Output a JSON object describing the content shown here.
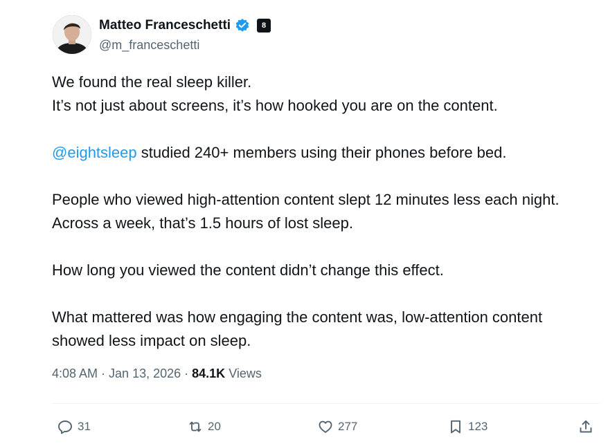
{
  "author": {
    "display_name": "Matteo Franceschetti",
    "handle": "@m_franceschetti",
    "affiliation_badge": "8"
  },
  "tweet": {
    "line1": "We found the real sleep killer.",
    "line2": "It’s not just about screens, it’s how hooked you are on the content.",
    "mention": "@eightsleep",
    "mention_rest": " studied 240+ members using their phones before bed.",
    "para3": "People who viewed high-attention content slept 12 minutes less each night. Across a week, that’s 1.5 hours of lost sleep.",
    "para4": "How long you viewed the content didn’t change this effect.",
    "para5": "What mattered was how engaging the content was, low-attention content showed less impact on sleep."
  },
  "meta": {
    "time": "4:08 AM",
    "sep1": " · ",
    "date": "Jan 13, 2026",
    "sep2": " · ",
    "views_count": "84.1K",
    "views_label": " Views"
  },
  "actions": {
    "replies": "31",
    "reposts": "20",
    "likes": "277",
    "bookmarks": "123"
  },
  "colors": {
    "text": "#0f1419",
    "secondary": "#536471",
    "accent": "#1d9bf0"
  },
  "icons": [
    "verified-icon",
    "reply-icon",
    "repost-icon",
    "like-icon",
    "bookmark-icon",
    "share-icon"
  ]
}
